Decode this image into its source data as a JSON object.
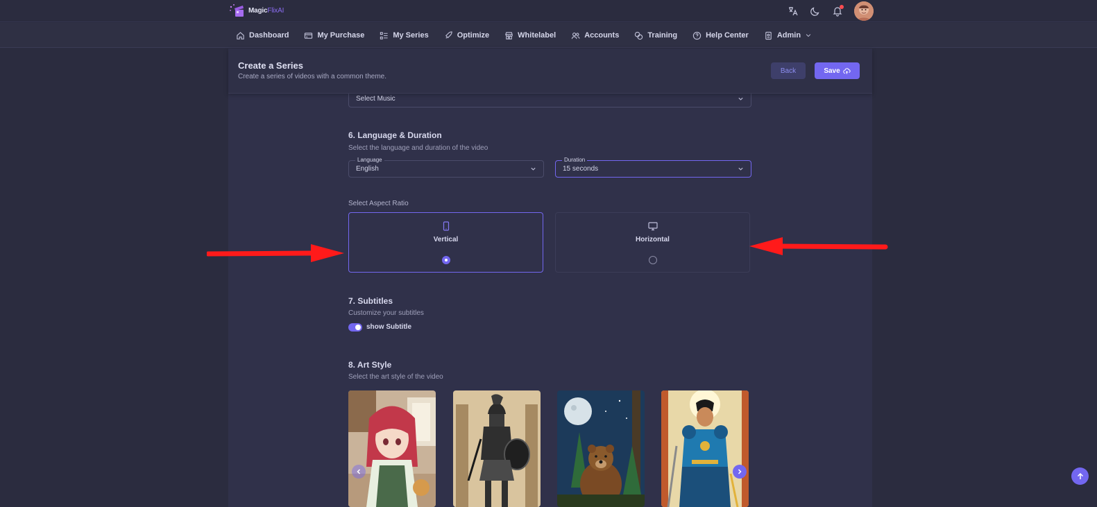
{
  "app": {
    "logo_primary": "Magic",
    "logo_accent": "FlixAI"
  },
  "topbar": {
    "icons": [
      "translate-icon",
      "moon-icon",
      "bell-icon",
      "avatar"
    ]
  },
  "nav": {
    "items": [
      {
        "label": "Dashboard",
        "icon": "home-icon"
      },
      {
        "label": "My Purchase",
        "icon": "card-icon"
      },
      {
        "label": "My Series",
        "icon": "list-icon"
      },
      {
        "label": "Optimize",
        "icon": "rocket-icon"
      },
      {
        "label": "Whitelabel",
        "icon": "store-icon"
      },
      {
        "label": "Accounts",
        "icon": "users-icon"
      },
      {
        "label": "Training",
        "icon": "copy-icon"
      },
      {
        "label": "Help Center",
        "icon": "help-icon"
      },
      {
        "label": "Admin",
        "icon": "badge-icon"
      }
    ]
  },
  "header": {
    "title": "Create a Series",
    "subtitle": "Create a series of videos with a common theme.",
    "back_label": "Back",
    "save_label": "Save"
  },
  "music": {
    "placeholder": "Select Music"
  },
  "language_duration": {
    "title": "6. Language & Duration",
    "subtitle": "Select the language and duration of the video",
    "language_label": "Language",
    "language_value": "English",
    "duration_label": "Duration",
    "duration_value": "15 seconds"
  },
  "aspect_ratio": {
    "label": "Select Aspect Ratio",
    "options": [
      {
        "name": "Vertical",
        "selected": true,
        "icon": "smartphone-icon"
      },
      {
        "name": "Horizontal",
        "selected": false,
        "icon": "monitor-icon"
      }
    ]
  },
  "subtitles": {
    "title": "7. Subtitles",
    "subtitle": "Customize your subtitles",
    "toggle_label": "show Subtitle",
    "enabled": true
  },
  "art_style": {
    "title": "8. Art Style",
    "subtitle": "Select the art style of the video",
    "styles": [
      "anime-girl-image",
      "spartan-warrior-image",
      "bear-night-image",
      "comic-hero-image"
    ]
  },
  "colors": {
    "accent": "#7367f0",
    "background": "#2b2c3f",
    "panel": "#30314a",
    "annotation_arrow": "#ff1a1a"
  }
}
